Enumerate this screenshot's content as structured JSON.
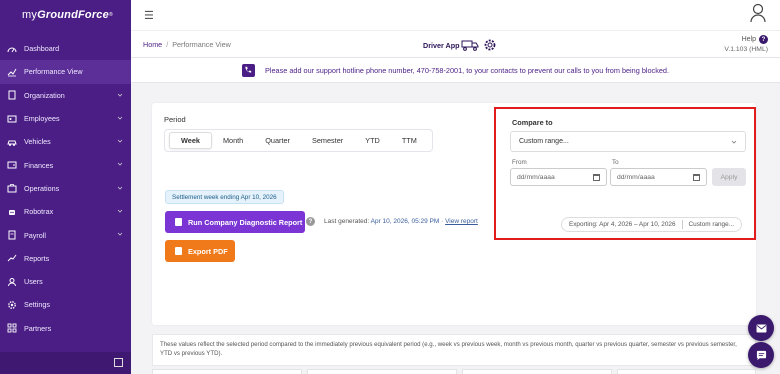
{
  "app": {
    "logo_light": "my",
    "logo_bold": "GroundForce",
    "logo_mark": "®"
  },
  "sidebar": {
    "items": [
      {
        "label": "Dashboard",
        "icon": "dashboard-icon",
        "expandable": false
      },
      {
        "label": "Performance View",
        "icon": "chart-icon",
        "expandable": false,
        "active": true
      },
      {
        "label": "Organization",
        "icon": "building-icon",
        "expandable": true
      },
      {
        "label": "Employees",
        "icon": "id-card-icon",
        "expandable": true
      },
      {
        "label": "Vehicles",
        "icon": "car-icon",
        "expandable": true
      },
      {
        "label": "Finances",
        "icon": "wallet-icon",
        "expandable": true
      },
      {
        "label": "Operations",
        "icon": "briefcase-icon",
        "expandable": true
      },
      {
        "label": "Robotrax",
        "icon": "robot-icon",
        "expandable": true
      },
      {
        "label": "Payroll",
        "icon": "payroll-icon",
        "expandable": true
      },
      {
        "label": "Reports",
        "icon": "reports-icon",
        "expandable": false
      },
      {
        "label": "Users",
        "icon": "users-icon",
        "expandable": false
      },
      {
        "label": "Settings",
        "icon": "settings-icon",
        "expandable": false
      },
      {
        "label": "Partners",
        "icon": "partners-icon",
        "expandable": false
      }
    ]
  },
  "breadcrumb": {
    "home": "Home",
    "separator": "/",
    "current": "Performance View"
  },
  "driver_app": {
    "label": "Driver App"
  },
  "help": {
    "label": "Help",
    "icon_text": "?",
    "version": "V.1.103 (HML)"
  },
  "notice": {
    "text": "Please add our support hotline phone number, 470-758-2001, to your contacts to prevent our calls to you from being blocked."
  },
  "period": {
    "label": "Period",
    "tabs": [
      "Week",
      "Month",
      "Quarter",
      "Semester",
      "YTD",
      "TTM"
    ],
    "active_tab": "Week"
  },
  "settlement_badge": "Settlement week ending Apr 10, 2026",
  "diagnostic": {
    "button_label": "Run Company Diagnostic Report",
    "info_icon_text": "?",
    "last_generated_prefix": "Last generated:",
    "last_generated_date": "Apr 10, 2026, 05:29 PM",
    "link_separator": "·",
    "view_report": "View report"
  },
  "export_pdf": {
    "label": "Export PDF"
  },
  "compare": {
    "title": "Compare to",
    "select_value": "Custom range...",
    "from_label": "From",
    "to_label": "To",
    "from_placeholder": "dd/mm/aaaa",
    "to_placeholder": "dd/mm/aaaa",
    "apply_label": "Apply",
    "exporting_text": "Exporting: Apr 4, 2026 – Apr 10, 2026",
    "exporting_mode": "Custom range..."
  },
  "footnote": "These values reflect the selected period compared to the immediately previous equivalent period (e.g., week vs previous week, month vs previous month, quarter vs previous quarter, semester vs previous semester, YTD vs previous YTD).",
  "colors": {
    "sidebar_bg": "#4b1e85",
    "accent_purple": "#7a35d4",
    "accent_orange": "#f07a1a",
    "highlight_border": "#e01c1c",
    "fab_bg": "#3b1a6e"
  }
}
